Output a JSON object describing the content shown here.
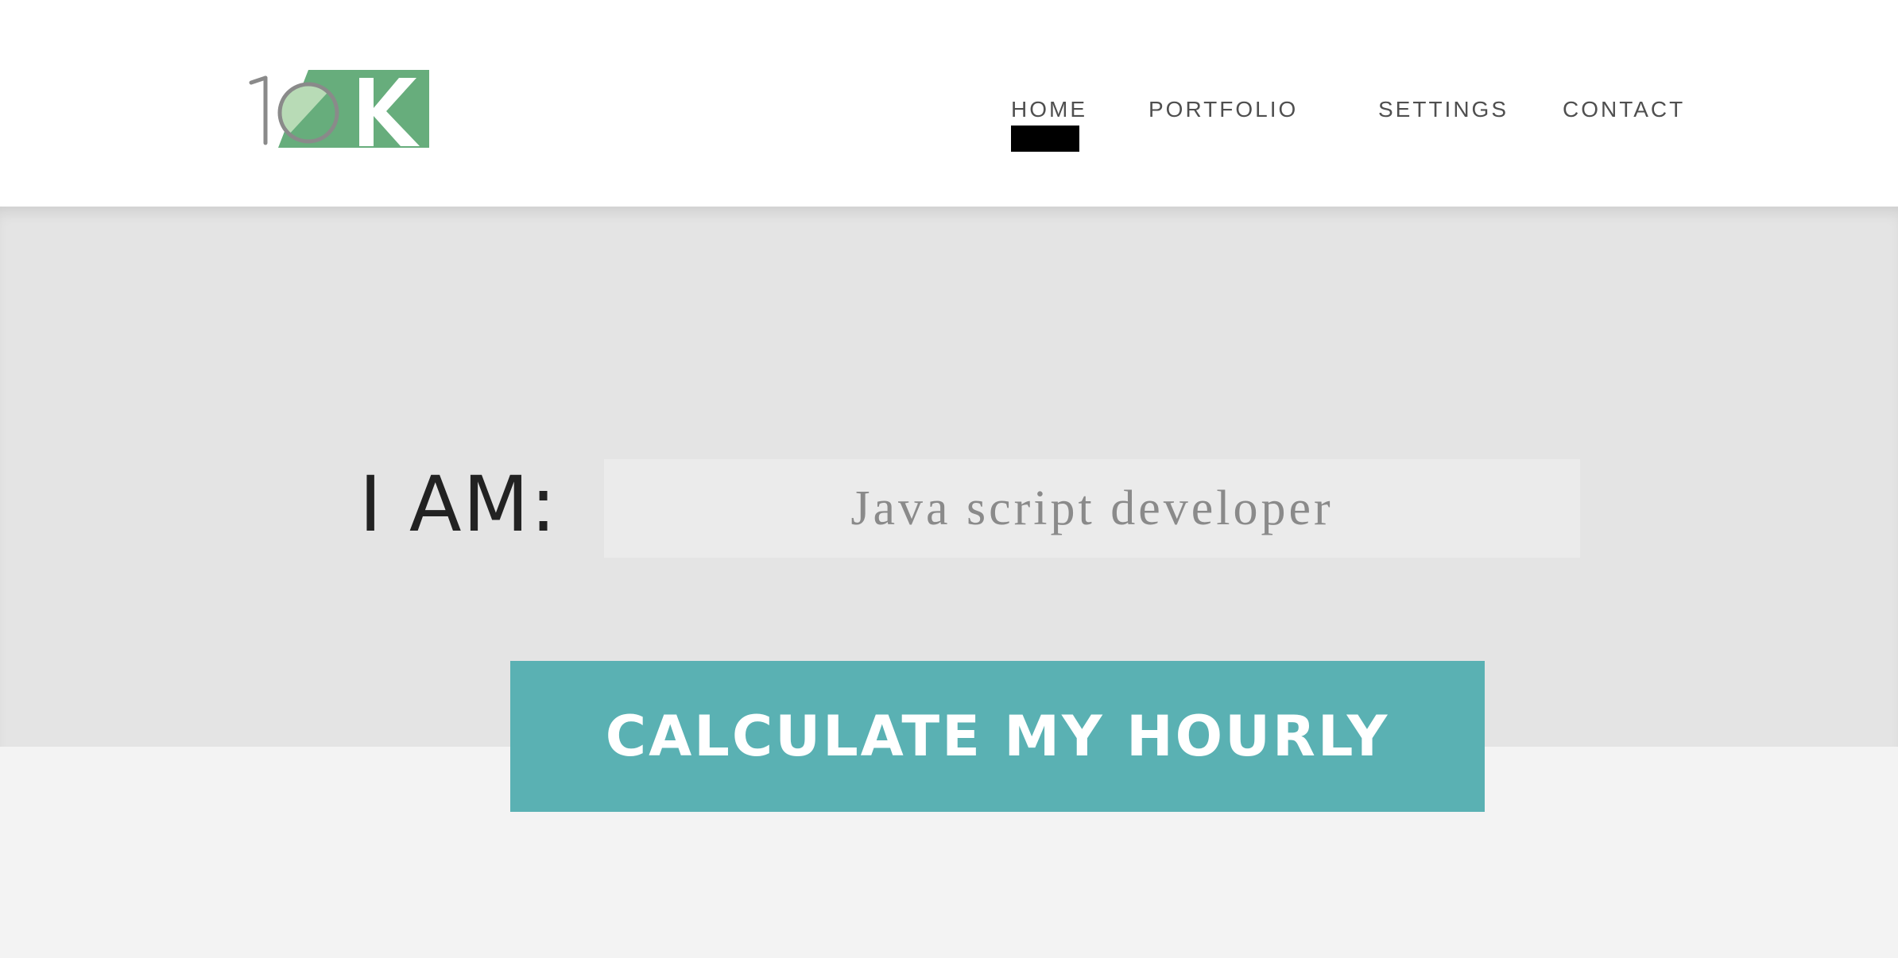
{
  "logo": {
    "text": "10K",
    "brand_color": "#67ad7c",
    "accent_light": "#b8dbb6"
  },
  "nav": {
    "items": [
      {
        "label": "HOME",
        "active": true
      },
      {
        "label": "PORTFOLIO",
        "active": false
      },
      {
        "label": "SETTINGS",
        "active": false
      },
      {
        "label": "CONTACT",
        "active": false
      }
    ]
  },
  "hero": {
    "label": "I AM:",
    "role_input": {
      "value": "Java script developer",
      "placeholder": ""
    },
    "button_label": "CALCULATE MY HOURLY"
  },
  "colors": {
    "button_bg": "#5ab1b3",
    "hero_bg": "#e4e4e4",
    "lower_bg": "#f3f3f3",
    "nav_indicator": "#000000"
  }
}
